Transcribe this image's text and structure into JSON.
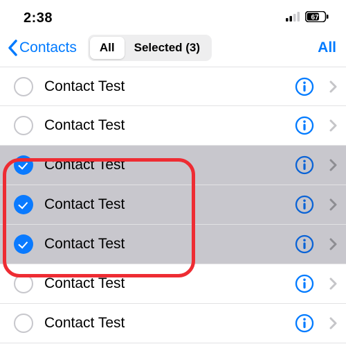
{
  "status": {
    "time": "2:38",
    "battery_percent": "67"
  },
  "nav": {
    "back_label": "Contacts",
    "seg_all": "All",
    "seg_selected": "Selected (3)",
    "action": "All"
  },
  "colors": {
    "ios_blue": "#007aff",
    "row_selected": "#c8c7cd"
  },
  "contacts": [
    {
      "name": "Contact Test",
      "selected": false
    },
    {
      "name": "Contact Test",
      "selected": false
    },
    {
      "name": "Contact Test",
      "selected": true
    },
    {
      "name": "Contact Test",
      "selected": true
    },
    {
      "name": "Contact Test",
      "selected": true
    },
    {
      "name": "Contact Test",
      "selected": false
    },
    {
      "name": "Contact Test",
      "selected": false
    }
  ]
}
